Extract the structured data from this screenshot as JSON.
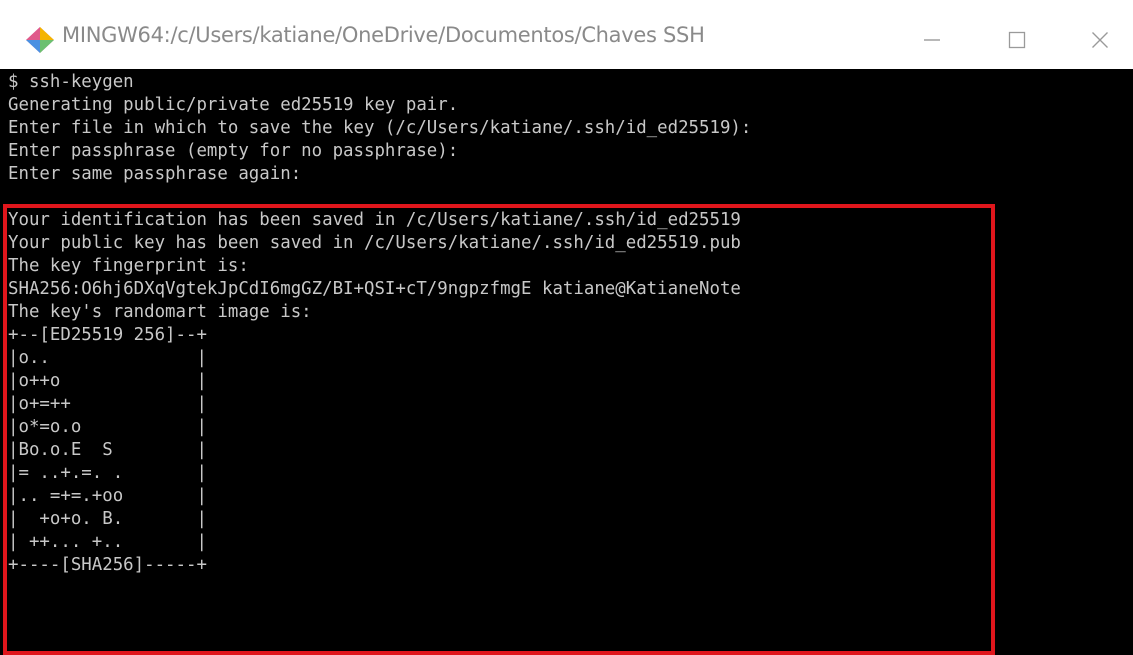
{
  "window": {
    "title": "MINGW64:/c/Users/katiane/OneDrive/Documentos/Chaves SSH",
    "icon": "git-bash-diamond-icon",
    "controls": {
      "minimize_glyph": "—",
      "maximize_glyph": "☐",
      "close_glyph": "✕"
    }
  },
  "colors": {
    "terminal_bg": "#000000",
    "terminal_fg": "#c8c8c8",
    "titlebar_bg": "#ffffff",
    "highlight": "#e0161c"
  },
  "terminal": {
    "lines": [
      "$ ssh-keygen",
      "Generating public/private ed25519 key pair.",
      "Enter file in which to save the key (/c/Users/katiane/.ssh/id_ed25519):",
      "Enter passphrase (empty for no passphrase):",
      "Enter same passphrase again:",
      "Your identification has been saved in /c/Users/katiane/.ssh/id_ed25519",
      "Your public key has been saved in /c/Users/katiane/.ssh/id_ed25519.pub",
      "The key fingerprint is:",
      "SHA256:O6hj6DXqVgtekJpCdI6mgGZ/BI+QSI+cT/9ngpzfmgE katiane@KatianeNote",
      "The key's randomart image is:",
      "+--[ED25519 256]--+",
      "|o..              |",
      "|o++o             |",
      "|o+=++            |",
      "|o*=o.o           |",
      "|Bo.o.E  S        |",
      "|= ..+.=. .       |",
      "|.. =+=.+oo       |",
      "|  +o+o. B.       |",
      "| ++... +..       |",
      "+----[SHA256]-----+"
    ]
  }
}
